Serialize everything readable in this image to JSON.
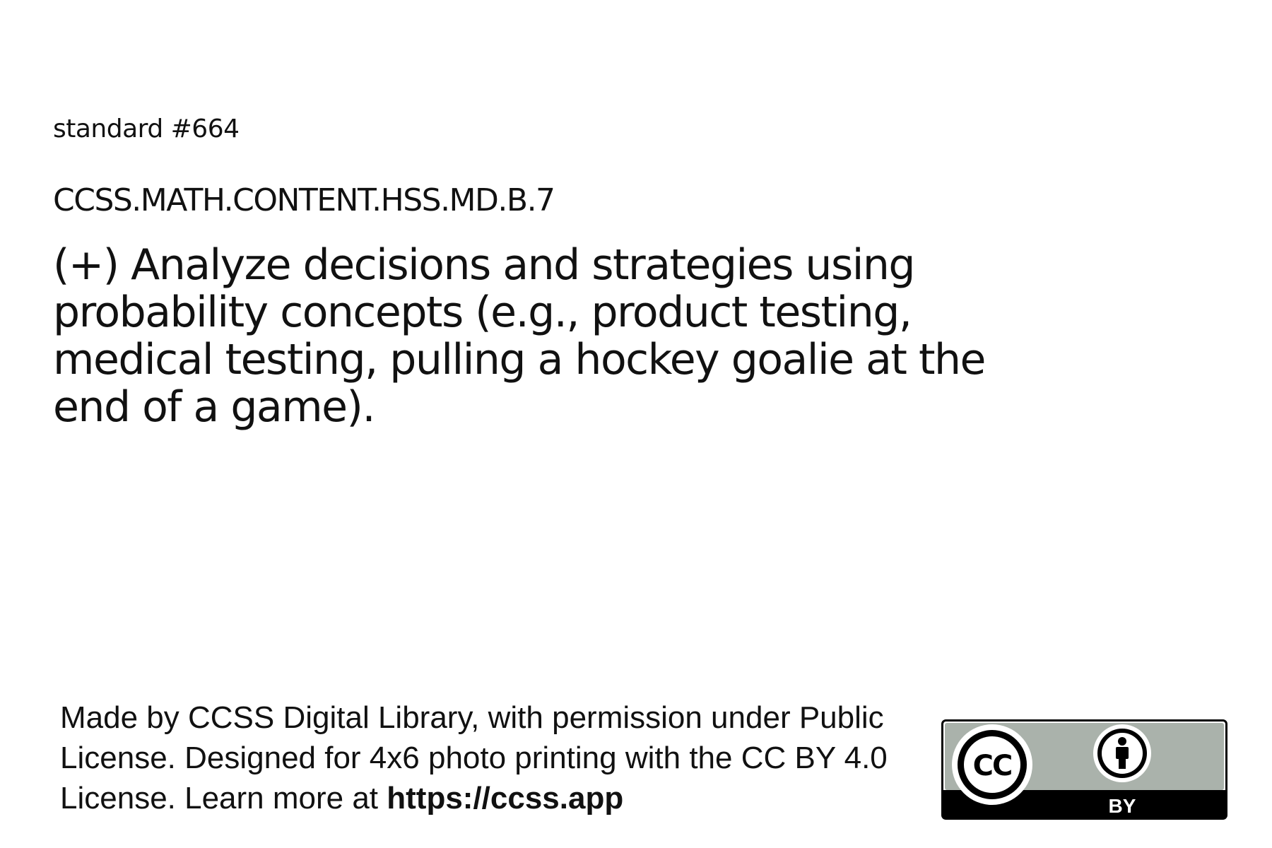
{
  "standard": {
    "number_label": "standard #664",
    "code": "CCSS.MATH.CONTENT.HSS.MD.B.7",
    "text": "(+) Analyze decisions and strategies using probability concepts (e.g., product testing, medical testing, pulling a hockey goalie at the end of a game)."
  },
  "footer": {
    "attribution_text": "Made by CCSS Digital Library, with permission under Public License. Designed for 4x6 photo printing with the CC BY 4.0 License. Learn more at ",
    "url": "https://ccss.app"
  },
  "license_badge": {
    "cc_text": "CC",
    "by_text": "BY",
    "colors": {
      "badge_gray": "#aab2ab",
      "black": "#000000",
      "white": "#ffffff"
    }
  }
}
